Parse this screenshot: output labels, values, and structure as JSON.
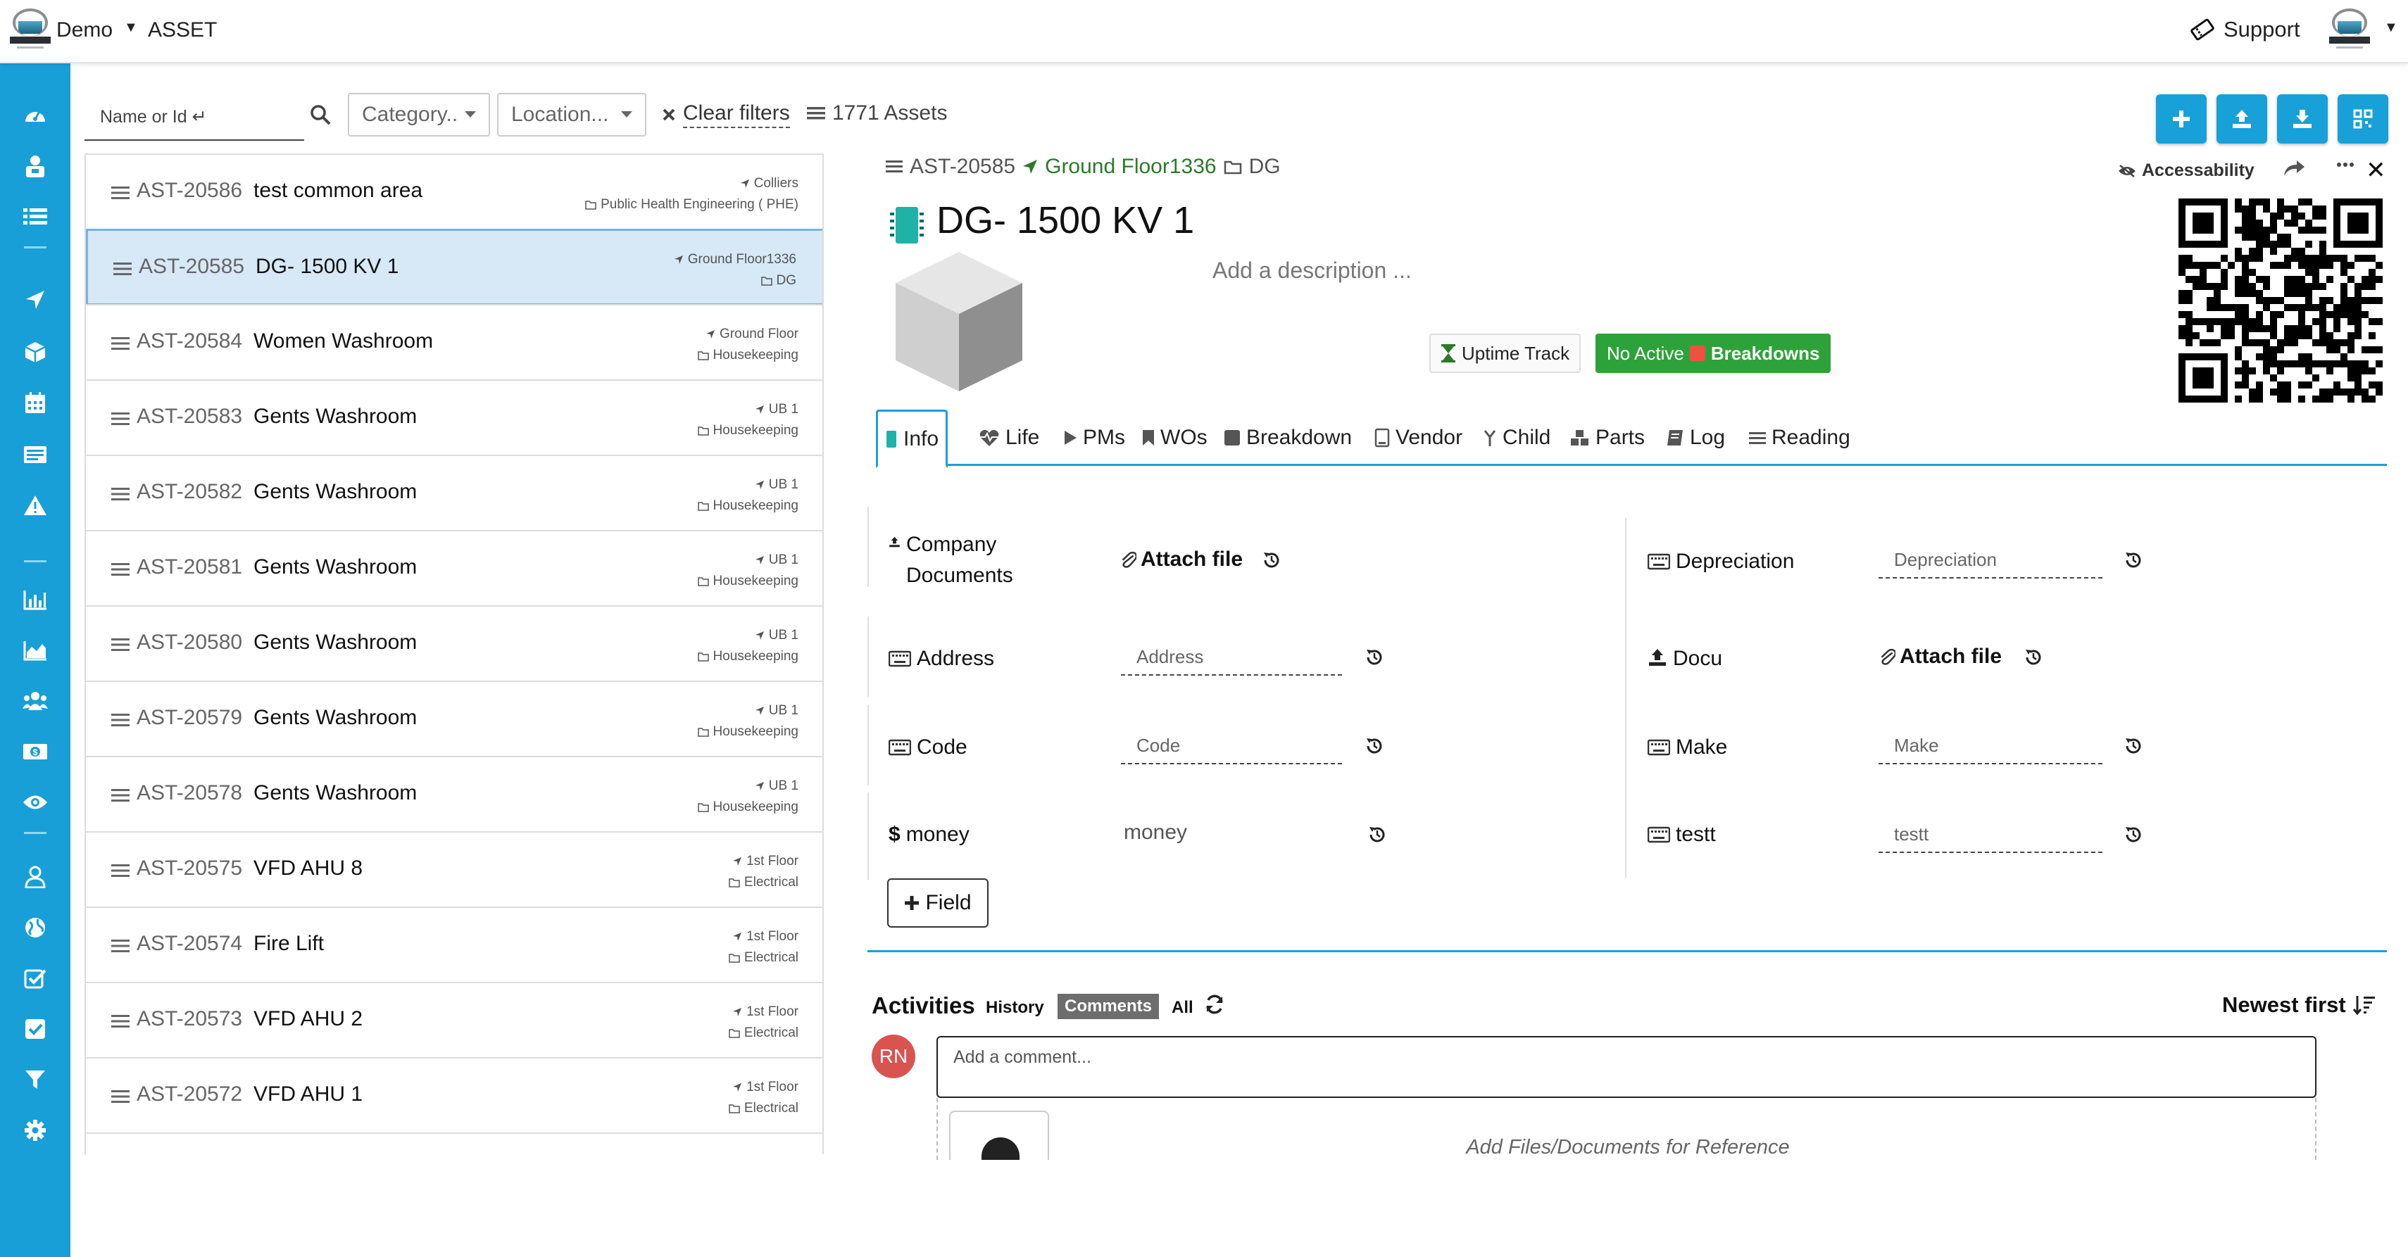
{
  "topbar": {
    "org": "Demo",
    "module": "ASSET",
    "support": "Support"
  },
  "sidebar": {
    "icons": [
      "dashboard-icon",
      "asset-icon",
      "list-icon",
      "location-icon",
      "parts-icon",
      "calendar-icon",
      "workorders-icon",
      "alert-icon",
      "chart-bar-icon",
      "chart-area-icon",
      "users-icon",
      "money-icon",
      "eye-icon",
      "user-icon",
      "globe-icon",
      "checklist-icon",
      "check-icon",
      "filter-icon",
      "settings-icon"
    ]
  },
  "filters": {
    "search_placeholder": "Name or Id ↵",
    "category": "Category..",
    "location": "Location...",
    "clear": "Clear filters",
    "count": "1771 Assets"
  },
  "assets": [
    {
      "id": "AST-20586",
      "name": "test common area",
      "location": "Colliers",
      "category": "Public Health Engineering ( PHE)"
    },
    {
      "id": "AST-20585",
      "name": "DG- 1500 KV 1",
      "location": "Ground Floor1336",
      "category": "DG"
    },
    {
      "id": "AST-20584",
      "name": "Women Washroom",
      "location": "Ground Floor",
      "category": "Housekeeping"
    },
    {
      "id": "AST-20583",
      "name": "Gents Washroom",
      "location": "UB 1",
      "category": "Housekeeping"
    },
    {
      "id": "AST-20582",
      "name": "Gents Washroom",
      "location": "UB 1",
      "category": "Housekeeping"
    },
    {
      "id": "AST-20581",
      "name": "Gents Washroom",
      "location": "UB 1",
      "category": "Housekeeping"
    },
    {
      "id": "AST-20580",
      "name": "Gents Washroom",
      "location": "UB 1",
      "category": "Housekeeping"
    },
    {
      "id": "AST-20579",
      "name": "Gents Washroom",
      "location": "UB 1",
      "category": "Housekeeping"
    },
    {
      "id": "AST-20578",
      "name": "Gents Washroom",
      "location": "UB 1",
      "category": "Housekeeping"
    },
    {
      "id": "AST-20575",
      "name": "VFD AHU 8",
      "location": "1st Floor",
      "category": "Electrical"
    },
    {
      "id": "AST-20574",
      "name": "Fire Lift",
      "location": "1st Floor",
      "category": "Electrical"
    },
    {
      "id": "AST-20573",
      "name": "VFD AHU 2",
      "location": "1st Floor",
      "category": "Electrical"
    },
    {
      "id": "AST-20572",
      "name": "VFD AHU 1",
      "location": "1st Floor",
      "category": "Electrical"
    }
  ],
  "detail": {
    "breadcrumb": {
      "id": "AST-20585",
      "location": "Ground Floor1336",
      "category": "DG"
    },
    "accessibility": "Accessability",
    "title": "DG- 1500 KV 1",
    "description": "Add a description ...",
    "uptime": "Uptime Track",
    "status": {
      "prefix": "No Active",
      "label": "Breakdowns"
    },
    "colors": {
      "accent": "#18a0d8",
      "status_green": "#2ea23a",
      "breakdown_red": "#f24e43"
    }
  },
  "tabs": [
    "Info",
    "Life",
    "PMs",
    "WOs",
    "Breakdown",
    "Vendor",
    "Child",
    "Parts",
    "Log",
    "Reading"
  ],
  "form": {
    "company_docs": "Company Documents",
    "attach_file": "Attach file",
    "depreciation_label": "Depreciation",
    "depreciation_placeholder": "Depreciation",
    "address_label": "Address",
    "address_placeholder": "Address",
    "docu_label": "Docu",
    "code_label": "Code",
    "code_placeholder": "Code",
    "make_label": "Make",
    "make_placeholder": "Make",
    "money_label": "money",
    "money_value": "money",
    "testt_label": "testt",
    "testt_placeholder": "testt",
    "add_field": "Field"
  },
  "activities": {
    "title": "Activities",
    "history": "History",
    "comments": "Comments",
    "all": "All",
    "sort": "Newest first",
    "avatar": "RN",
    "comment_placeholder": "Add a comment...",
    "dropzone": "Add Files/Documents for Reference"
  }
}
